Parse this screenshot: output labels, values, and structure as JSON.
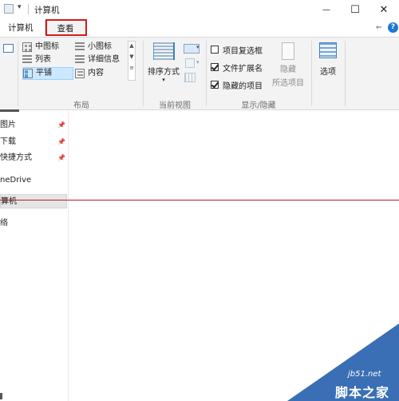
{
  "window": {
    "title": "计算机",
    "minimize_glyph": "—",
    "maximize_glyph": "☐",
    "close_glyph": "✕"
  },
  "ribbon_tabs": [
    {
      "label": "计算机"
    },
    {
      "label": "查看"
    }
  ],
  "layout_group": {
    "label": "布局",
    "items": [
      {
        "label": "中图标",
        "selected": false
      },
      {
        "label": "小图标",
        "selected": false
      },
      {
        "label": "列表",
        "selected": false
      },
      {
        "label": "详细信息",
        "selected": false
      },
      {
        "label": "平铺",
        "selected": true
      },
      {
        "label": "内容",
        "selected": false
      }
    ]
  },
  "current_view_group": {
    "label": "当前视图",
    "sort_label": "排序方式"
  },
  "show_hide_group": {
    "label": "显示/隐藏",
    "options": [
      {
        "label": "项目复选框",
        "checked": false
      },
      {
        "label": "文件扩展名",
        "checked": true
      },
      {
        "label": "隐藏的项目",
        "checked": true
      }
    ],
    "hide_label": "隐藏",
    "hide_sub": "所选项目"
  },
  "options_label": "选项",
  "nav": {
    "items": [
      {
        "label": "图片"
      },
      {
        "label": "下载"
      },
      {
        "label": "快捷方式"
      },
      {
        "label": "neDrive"
      },
      {
        "label": "算机"
      },
      {
        "label": "络"
      }
    ]
  },
  "watermark": {
    "site": "jb51.net",
    "name": "脚本之家"
  },
  "colors": {
    "highlight_red": "#d41a1a",
    "ribbon_bg": "#f3f3f3",
    "selected_bg": "#cce8ff",
    "watermark_blue": "#3a6fb5"
  }
}
